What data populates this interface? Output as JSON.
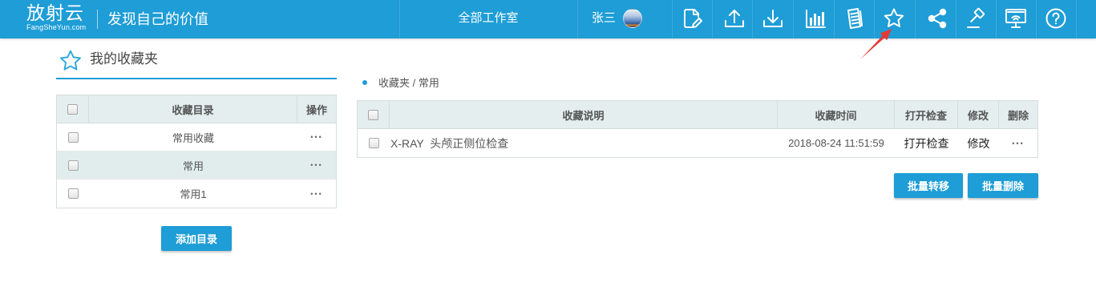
{
  "colors": {
    "brand_blue": "#1e9dd6",
    "table_header_bg": "#e4eeee",
    "selected_row_bg": "#e1eded",
    "border": "#d6dcdc",
    "annotation_red": "#e53935"
  },
  "header": {
    "logo_main": "放射云",
    "logo_sub": "FangSheYun.com",
    "slogan": "发现自己的价值",
    "studio": "全部工作室",
    "user_name": "张三",
    "toolbar_icons": [
      "edit-document-icon",
      "upload-icon",
      "download-icon",
      "bar-chart-icon",
      "report-document-icon",
      "star-icon",
      "share-icon",
      "gavel-icon",
      "monitor-icon",
      "help-icon"
    ]
  },
  "favorites_panel": {
    "title": "我的收藏夹",
    "title_icon": "star-outline-icon",
    "columns": {
      "directory": "收藏目录",
      "action": "操作"
    },
    "rows": [
      {
        "name": "常用收藏",
        "action": "•••",
        "selected": false,
        "checked": false
      },
      {
        "name": "常用",
        "action": "•••",
        "selected": true,
        "checked": false
      },
      {
        "name": "常用1",
        "action": "•••",
        "selected": false,
        "checked": false
      }
    ],
    "add_button": "添加目录"
  },
  "detail_panel": {
    "breadcrumb": "收藏夹 / 常用",
    "columns": {
      "description": "收藏说明",
      "time": "收藏时间",
      "open": "打开检查",
      "edit": "修改",
      "delete": "删除"
    },
    "rows": [
      {
        "description": "X-RAY  头颅正侧位检查",
        "time": "2018-08-24 11:51:59",
        "open": "打开检查",
        "edit": "修改",
        "delete": "•••",
        "checked": false
      }
    ],
    "batch_move_button": "批量转移",
    "batch_delete_button": "批量删除"
  }
}
